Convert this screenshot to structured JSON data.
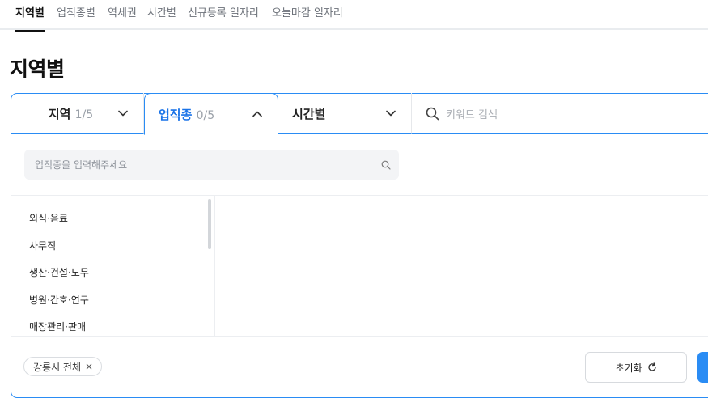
{
  "top_tabs": [
    {
      "label": "지역별",
      "active": true
    },
    {
      "label": "업직종별",
      "active": false
    },
    {
      "label": "역세권",
      "active": false
    },
    {
      "label": "시간별",
      "active": false
    },
    {
      "label": "신규등록 일자리",
      "active": false
    },
    {
      "label": "오늘마감 일자리",
      "active": false
    }
  ],
  "page_title": "지역별",
  "filters": {
    "region": {
      "label": "지역",
      "count": "1/5",
      "icon": "chevron-down-icon"
    },
    "job": {
      "label": "업직종",
      "count": "0/5",
      "icon": "chevron-up-icon"
    },
    "time": {
      "label": "시간별",
      "icon": "chevron-down-icon"
    },
    "keyword": {
      "placeholder": "키워드 검색",
      "icon": "search-icon"
    }
  },
  "job_search": {
    "placeholder": "업직종을 입력해주세요"
  },
  "categories": [
    "외식·음료",
    "사무직",
    "생산·건설·노무",
    "병원·간호·연구",
    "매장관리·판매"
  ],
  "selected_chips": [
    {
      "label": "강릉시 전체",
      "remove": "×"
    }
  ],
  "buttons": {
    "reset": "초기화"
  },
  "colors": {
    "accent": "#2a8cf4",
    "active_text": "#1a73e8"
  }
}
